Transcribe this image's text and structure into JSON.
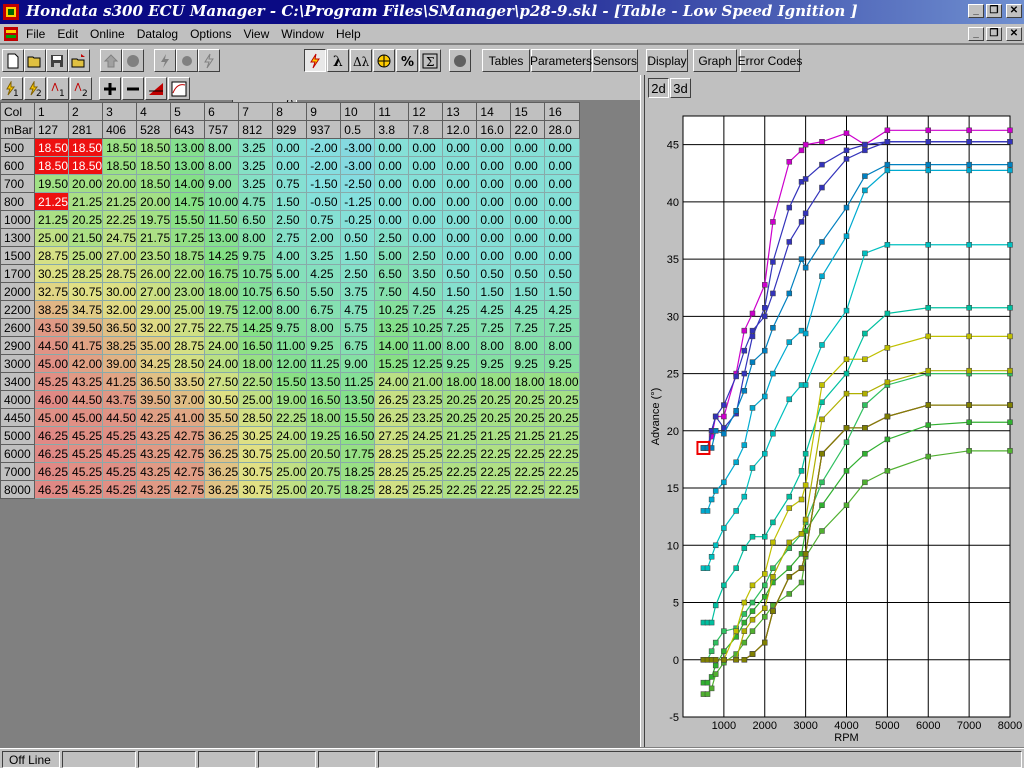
{
  "window": {
    "title": "Hondata s300 ECU Manager - C:\\Program Files\\SManager\\p28-9.skl - [Table - Low Speed Ignition ]"
  },
  "menu": [
    "File",
    "Edit",
    "Online",
    "Datalog",
    "Options",
    "View",
    "Window",
    "Help"
  ],
  "toolbar": {
    "value": "0",
    "tables_label": "Tables",
    "parameters_label": "Parameters",
    "sensors_label": "Sensors",
    "display_label": "Display",
    "graph_label": "Graph",
    "error_codes_label": "Error Codes"
  },
  "tabs": [
    "2d",
    "3d"
  ],
  "table": {
    "col_header": "Col",
    "load_header": "mBar",
    "columns": [
      "1",
      "2",
      "3",
      "4",
      "5",
      "6",
      "7",
      "8",
      "9",
      "10",
      "11",
      "12",
      "13",
      "14",
      "15",
      "16"
    ],
    "loads": [
      "127",
      "281",
      "406",
      "528",
      "643",
      "757",
      "812",
      "929",
      "937",
      "0.5",
      "3.8",
      "7.8",
      "12.0",
      "16.0",
      "22.0",
      "28.0"
    ],
    "rpm": [
      "500",
      "600",
      "700",
      "800",
      "1000",
      "1300",
      "1500",
      "1700",
      "2000",
      "2200",
      "2600",
      "2900",
      "3000",
      "3400",
      "4000",
      "4450",
      "5000",
      "6000",
      "7000",
      "8000"
    ],
    "rows": [
      [
        "18.50",
        "18.50",
        "18.50",
        "18.50",
        "13.00",
        "8.00",
        "3.25",
        "0.00",
        "-2.00",
        "-3.00",
        "0.00",
        "0.00",
        "0.00",
        "0.00",
        "0.00",
        "0.00"
      ],
      [
        "18.50",
        "18.50",
        "18.50",
        "18.50",
        "13.00",
        "8.00",
        "3.25",
        "0.00",
        "-2.00",
        "-3.00",
        "0.00",
        "0.00",
        "0.00",
        "0.00",
        "0.00",
        "0.00"
      ],
      [
        "19.50",
        "20.00",
        "20.00",
        "18.50",
        "14.00",
        "9.00",
        "3.25",
        "0.75",
        "-1.50",
        "-2.50",
        "0.00",
        "0.00",
        "0.00",
        "0.00",
        "0.00",
        "0.00"
      ],
      [
        "21.25",
        "21.25",
        "21.25",
        "20.00",
        "14.75",
        "10.00",
        "4.75",
        "1.50",
        "-0.50",
        "-1.25",
        "0.00",
        "0.00",
        "0.00",
        "0.00",
        "0.00",
        "0.00"
      ],
      [
        "21.25",
        "20.25",
        "22.25",
        "19.75",
        "15.50",
        "11.50",
        "6.50",
        "2.50",
        "0.75",
        "-0.25",
        "0.00",
        "0.00",
        "0.00",
        "0.00",
        "0.00",
        "0.00"
      ],
      [
        "25.00",
        "21.50",
        "24.75",
        "21.75",
        "17.25",
        "13.00",
        "8.00",
        "2.75",
        "2.00",
        "0.50",
        "2.50",
        "0.00",
        "0.00",
        "0.00",
        "0.00",
        "0.00"
      ],
      [
        "28.75",
        "25.00",
        "27.00",
        "23.50",
        "18.75",
        "14.25",
        "9.75",
        "4.00",
        "3.25",
        "1.50",
        "5.00",
        "2.50",
        "0.00",
        "0.00",
        "0.00",
        "0.00"
      ],
      [
        "30.25",
        "28.25",
        "28.75",
        "26.00",
        "22.00",
        "16.75",
        "10.75",
        "5.00",
        "4.25",
        "2.50",
        "6.50",
        "3.50",
        "0.50",
        "0.50",
        "0.50",
        "0.50"
      ],
      [
        "32.75",
        "30.75",
        "30.00",
        "27.00",
        "23.00",
        "18.00",
        "10.75",
        "6.50",
        "5.50",
        "3.75",
        "7.50",
        "4.50",
        "1.50",
        "1.50",
        "1.50",
        "1.50"
      ],
      [
        "38.25",
        "34.75",
        "32.00",
        "29.00",
        "25.00",
        "19.75",
        "12.00",
        "8.00",
        "6.75",
        "4.75",
        "10.25",
        "7.25",
        "4.25",
        "4.25",
        "4.25",
        "4.25"
      ],
      [
        "43.50",
        "39.50",
        "36.50",
        "32.00",
        "27.75",
        "22.75",
        "14.25",
        "9.75",
        "8.00",
        "5.75",
        "13.25",
        "10.25",
        "7.25",
        "7.25",
        "7.25",
        "7.25"
      ],
      [
        "44.50",
        "41.75",
        "38.25",
        "35.00",
        "28.75",
        "24.00",
        "16.50",
        "11.00",
        "9.25",
        "6.75",
        "14.00",
        "11.00",
        "8.00",
        "8.00",
        "8.00",
        "8.00"
      ],
      [
        "45.00",
        "42.00",
        "39.00",
        "34.25",
        "28.50",
        "24.00",
        "18.00",
        "12.00",
        "11.25",
        "9.00",
        "15.25",
        "12.25",
        "9.25",
        "9.25",
        "9.25",
        "9.25"
      ],
      [
        "45.25",
        "43.25",
        "41.25",
        "36.50",
        "33.50",
        "27.50",
        "22.50",
        "15.50",
        "13.50",
        "11.25",
        "24.00",
        "21.00",
        "18.00",
        "18.00",
        "18.00",
        "18.00"
      ],
      [
        "46.00",
        "44.50",
        "43.75",
        "39.50",
        "37.00",
        "30.50",
        "25.00",
        "19.00",
        "16.50",
        "13.50",
        "26.25",
        "23.25",
        "20.25",
        "20.25",
        "20.25",
        "20.25"
      ],
      [
        "45.00",
        "45.00",
        "44.50",
        "42.25",
        "41.00",
        "35.50",
        "28.50",
        "22.25",
        "18.00",
        "15.50",
        "26.25",
        "23.25",
        "20.25",
        "20.25",
        "20.25",
        "20.25"
      ],
      [
        "46.25",
        "45.25",
        "45.25",
        "43.25",
        "42.75",
        "36.25",
        "30.25",
        "24.00",
        "19.25",
        "16.50",
        "27.25",
        "24.25",
        "21.25",
        "21.25",
        "21.25",
        "21.25"
      ],
      [
        "46.25",
        "45.25",
        "45.25",
        "43.25",
        "42.75",
        "36.25",
        "30.75",
        "25.00",
        "20.50",
        "17.75",
        "28.25",
        "25.25",
        "22.25",
        "22.25",
        "22.25",
        "22.25"
      ],
      [
        "46.25",
        "45.25",
        "45.25",
        "43.25",
        "42.75",
        "36.25",
        "30.75",
        "25.00",
        "20.75",
        "18.25",
        "28.25",
        "25.25",
        "22.25",
        "22.25",
        "22.25",
        "22.25"
      ],
      [
        "46.25",
        "45.25",
        "45.25",
        "43.25",
        "42.75",
        "36.25",
        "30.75",
        "25.00",
        "20.75",
        "18.25",
        "28.25",
        "25.25",
        "22.25",
        "22.25",
        "22.25",
        "22.25"
      ]
    ],
    "selected_cells": [
      [
        0,
        0
      ],
      [
        0,
        1
      ],
      [
        1,
        0
      ],
      [
        1,
        1
      ],
      [
        3,
        0
      ]
    ]
  },
  "chart_data": {
    "type": "line",
    "xlabel": "RPM",
    "ylabel": "Advance (°)",
    "xlim": [
      0,
      8000
    ],
    "ylim": [
      -5,
      47.5
    ],
    "x_ticks": [
      "1000",
      "2000",
      "3000",
      "4000",
      "5000",
      "6000",
      "7000",
      "8000"
    ],
    "y_ticks": [
      "-5",
      "0",
      "5",
      "10",
      "15",
      "20",
      "25",
      "30",
      "35",
      "40",
      "45"
    ],
    "grid": true,
    "series_colors": [
      "#cc00cc",
      "#3333bb",
      "#3333bb",
      "#0080c0",
      "#00aad0",
      "#00c0c0",
      "#00c0a0",
      "#30c060",
      "#30b030",
      "#50b030",
      "#c0c000",
      "#b0b000",
      "#a0a000",
      "#909000",
      "#cc44cc",
      "#808000"
    ]
  },
  "status": {
    "mode": "Off Line"
  }
}
